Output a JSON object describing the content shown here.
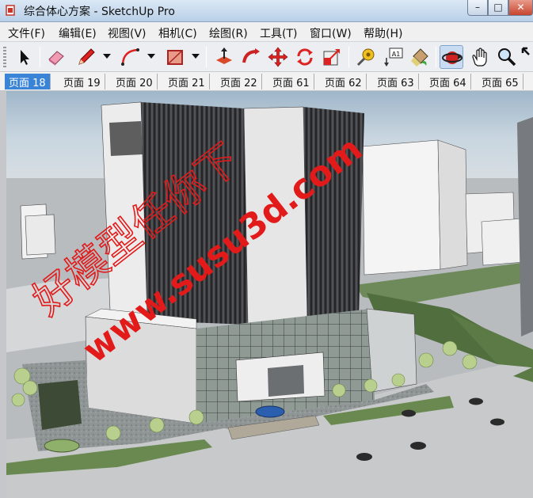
{
  "window": {
    "title": "综合体心方案 - SketchUp Pro",
    "minimize": "–",
    "maximize": "□",
    "close": "✕"
  },
  "menu": [
    "文件(F)",
    "编辑(E)",
    "视图(V)",
    "相机(C)",
    "绘图(R)",
    "工具(T)",
    "窗口(W)",
    "帮助(H)"
  ],
  "toolbar": {
    "tools": [
      "select-icon",
      "eraser-icon",
      "pencil-icon",
      "arc-icon",
      "rectangle-icon",
      "push-pull-icon",
      "follow-me-icon",
      "move-icon",
      "rotate-icon",
      "scale-icon",
      "tape-measure-icon",
      "text-icon",
      "paint-bucket-icon",
      "orbit-icon",
      "pan-icon",
      "zoom-icon",
      "zoom-extents-icon"
    ],
    "text_tool_label": "A1",
    "active_tool": "orbit-icon"
  },
  "scene_tabs": [
    "页面 18",
    "页面 19",
    "页面 20",
    "页面 21",
    "页面 22",
    "页面 61",
    "页面 62",
    "页面 63",
    "页面 64",
    "页面 65"
  ],
  "active_scene": "页面 18",
  "watermark": {
    "line1": "好模型任你下",
    "line2": "www.susu3d.com"
  },
  "colors": {
    "title_bar": "#c6d9ee",
    "active_tab": "#3a84d8",
    "watermark": "#e21a1a",
    "close_button": "#c6462f"
  }
}
